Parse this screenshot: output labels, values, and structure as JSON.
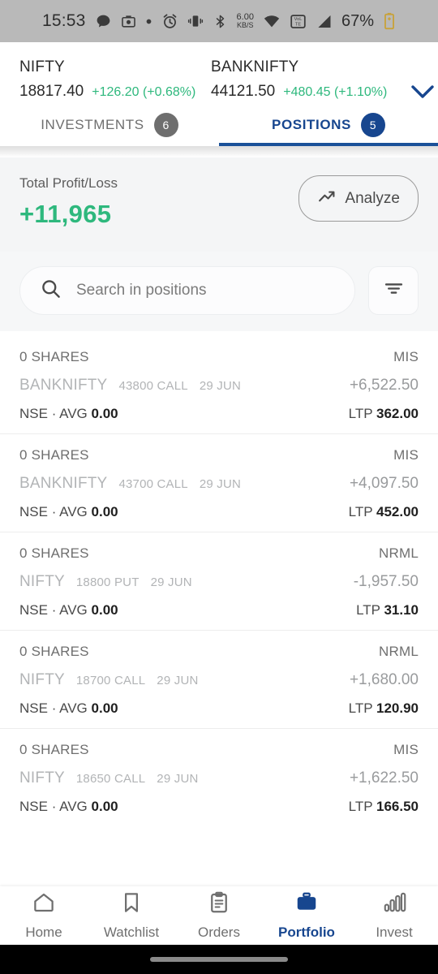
{
  "status_bar": {
    "time": "15:53",
    "battery": "67%",
    "network_speed": "6.00",
    "network_speed_unit": "KB/S",
    "volte_label": "VoLTE",
    "icons": [
      "chat-icon",
      "camera-icon",
      "dot-icon",
      "alarm-icon",
      "vibrate-icon",
      "bluetooth-icon",
      "wifi-icon",
      "volte-icon",
      "signal-icon",
      "battery-charging-icon"
    ]
  },
  "indices": [
    {
      "name": "NIFTY",
      "price": "18817.40",
      "change": "+126.20 (+0.68%)",
      "positive": true
    },
    {
      "name": "BANKNIFTY",
      "price": "44121.50",
      "change": "+480.45 (+1.10%)",
      "positive": true
    }
  ],
  "tabs": [
    {
      "label": "INVESTMENTS",
      "count": "6",
      "active": false
    },
    {
      "label": "POSITIONS",
      "count": "5",
      "active": true
    }
  ],
  "summary": {
    "label": "Total Profit/Loss",
    "value": "+11,965",
    "analyze_label": "Analyze"
  },
  "search": {
    "placeholder": "Search in positions",
    "value": ""
  },
  "positions": [
    {
      "qty": "0 SHARES",
      "product": "MIS",
      "symbol": "BANKNIFTY",
      "strike": "43800 CALL",
      "expiry": "29 JUN",
      "pnl": "+6,522.50",
      "exchange": "NSE",
      "avg_label": "AVG",
      "avg": "0.00",
      "ltp_label": "LTP",
      "ltp": "362.00"
    },
    {
      "qty": "0 SHARES",
      "product": "MIS",
      "symbol": "BANKNIFTY",
      "strike": "43700 CALL",
      "expiry": "29 JUN",
      "pnl": "+4,097.50",
      "exchange": "NSE",
      "avg_label": "AVG",
      "avg": "0.00",
      "ltp_label": "LTP",
      "ltp": "452.00"
    },
    {
      "qty": "0 SHARES",
      "product": "NRML",
      "symbol": "NIFTY",
      "strike": "18800 PUT",
      "expiry": "29 JUN",
      "pnl": "-1,957.50",
      "exchange": "NSE",
      "avg_label": "AVG",
      "avg": "0.00",
      "ltp_label": "LTP",
      "ltp": "31.10"
    },
    {
      "qty": "0 SHARES",
      "product": "NRML",
      "symbol": "NIFTY",
      "strike": "18700 CALL",
      "expiry": "29 JUN",
      "pnl": "+1,680.00",
      "exchange": "NSE",
      "avg_label": "AVG",
      "avg": "0.00",
      "ltp_label": "LTP",
      "ltp": "120.90"
    },
    {
      "qty": "0 SHARES",
      "product": "MIS",
      "symbol": "NIFTY",
      "strike": "18650 CALL",
      "expiry": "29 JUN",
      "pnl": "+1,622.50",
      "exchange": "NSE",
      "avg_label": "AVG",
      "avg": "0.00",
      "ltp_label": "LTP",
      "ltp": "166.50"
    }
  ],
  "bottom_nav": [
    {
      "label": "Home",
      "icon": "home-icon",
      "active": false
    },
    {
      "label": "Watchlist",
      "icon": "bookmark-icon",
      "active": false
    },
    {
      "label": "Orders",
      "icon": "clipboard-icon",
      "active": false
    },
    {
      "label": "Portfolio",
      "icon": "briefcase-icon",
      "active": true
    },
    {
      "label": "Invest",
      "icon": "bar-chart-icon",
      "active": false
    }
  ],
  "colors": {
    "accent_blue": "#17468f",
    "positive_green": "#2eb87d",
    "muted_gray": "#b2b4b6"
  }
}
